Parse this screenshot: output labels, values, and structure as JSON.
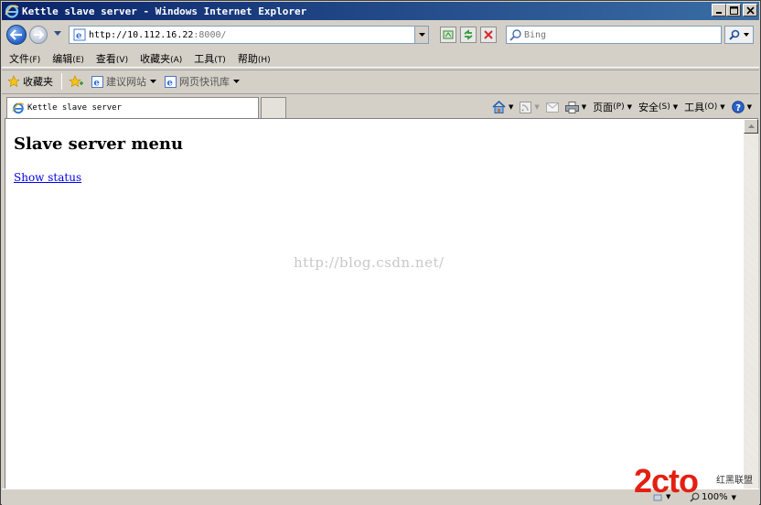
{
  "window": {
    "title": "Kettle slave server - Windows Internet Explorer"
  },
  "address": {
    "url_host": "http://10.112.16.22",
    "url_rest": ":8000/"
  },
  "search": {
    "placeholder": "Bing"
  },
  "menu": {
    "items": [
      {
        "label": "文件",
        "acc": "(F)"
      },
      {
        "label": "编辑",
        "acc": "(E)"
      },
      {
        "label": "查看",
        "acc": "(V)"
      },
      {
        "label": "收藏夹",
        "acc": "(A)"
      },
      {
        "label": "工具",
        "acc": "(T)"
      },
      {
        "label": "帮助",
        "acc": "(H)"
      }
    ]
  },
  "favorites": {
    "label": "收藏夹",
    "suggested": "建议网站",
    "webslice": "网页快讯库"
  },
  "tab": {
    "title": "Kettle slave server"
  },
  "commands": {
    "page": {
      "label": "页面",
      "acc": "(P)"
    },
    "safety": {
      "label": "安全",
      "acc": "(S)"
    },
    "tools": {
      "label": "工具",
      "acc": "(O)"
    }
  },
  "page": {
    "heading": "Slave server menu",
    "link": "Show status",
    "watermark": "http://blog.csdn.net/"
  },
  "status": {
    "zoom": "100%"
  },
  "logo": {
    "text": "2cto",
    "cn": "红黑联盟"
  },
  "colors": {
    "titlebar_start": "#0a246a",
    "titlebar_end": "#3a6ea5",
    "link": "#0000ee",
    "logo_red": "#e32012"
  }
}
